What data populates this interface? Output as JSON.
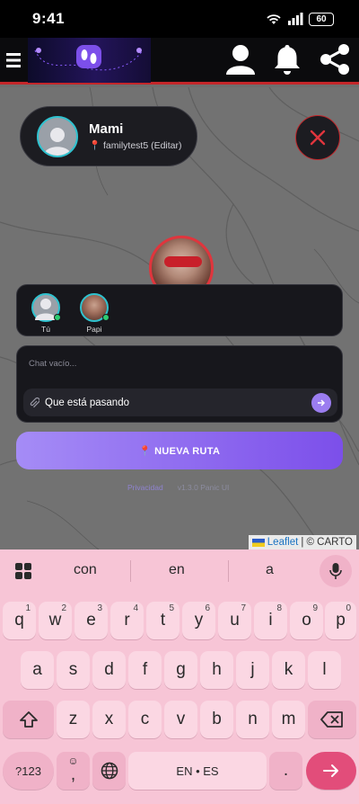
{
  "status_bar": {
    "time": "9:41",
    "battery": "60"
  },
  "profile": {
    "name": "Mami",
    "subtitle": "📍 familytest5 (Editar)"
  },
  "members": [
    {
      "label": "Tú"
    },
    {
      "label": "Papi"
    }
  ],
  "chat": {
    "empty_text": "Chat vacío...",
    "input_value": "Que está pasando"
  },
  "route_button": {
    "label": "📍 NUEVA RUTA"
  },
  "footer": {
    "privacy": "Privacidad",
    "version": "v1.3.0 Panic UI"
  },
  "map_attribution": {
    "leaflet": "Leaflet",
    "rest": "| © CARTO"
  },
  "keyboard": {
    "suggestions": [
      "con",
      "en",
      "a"
    ],
    "row1": [
      {
        "k": "q",
        "n": "1"
      },
      {
        "k": "w",
        "n": "2"
      },
      {
        "k": "e",
        "n": "3"
      },
      {
        "k": "r",
        "n": "4"
      },
      {
        "k": "t",
        "n": "5"
      },
      {
        "k": "y",
        "n": "6"
      },
      {
        "k": "u",
        "n": "7"
      },
      {
        "k": "i",
        "n": "8"
      },
      {
        "k": "o",
        "n": "9"
      },
      {
        "k": "p",
        "n": "0"
      }
    ],
    "row2": [
      "a",
      "s",
      "d",
      "f",
      "g",
      "h",
      "j",
      "k",
      "l"
    ],
    "row3": [
      "z",
      "x",
      "c",
      "v",
      "b",
      "n",
      "m"
    ],
    "symbols_key": "?123",
    "comma_key": ",",
    "space_key": "EN • ES",
    "period_key": "."
  },
  "colors": {
    "accent": "#c4262a",
    "purple": "#7c4fea",
    "teal": "#2fc2cf",
    "online": "#2ecc71",
    "keyboard_bg": "#f7c5d6"
  }
}
